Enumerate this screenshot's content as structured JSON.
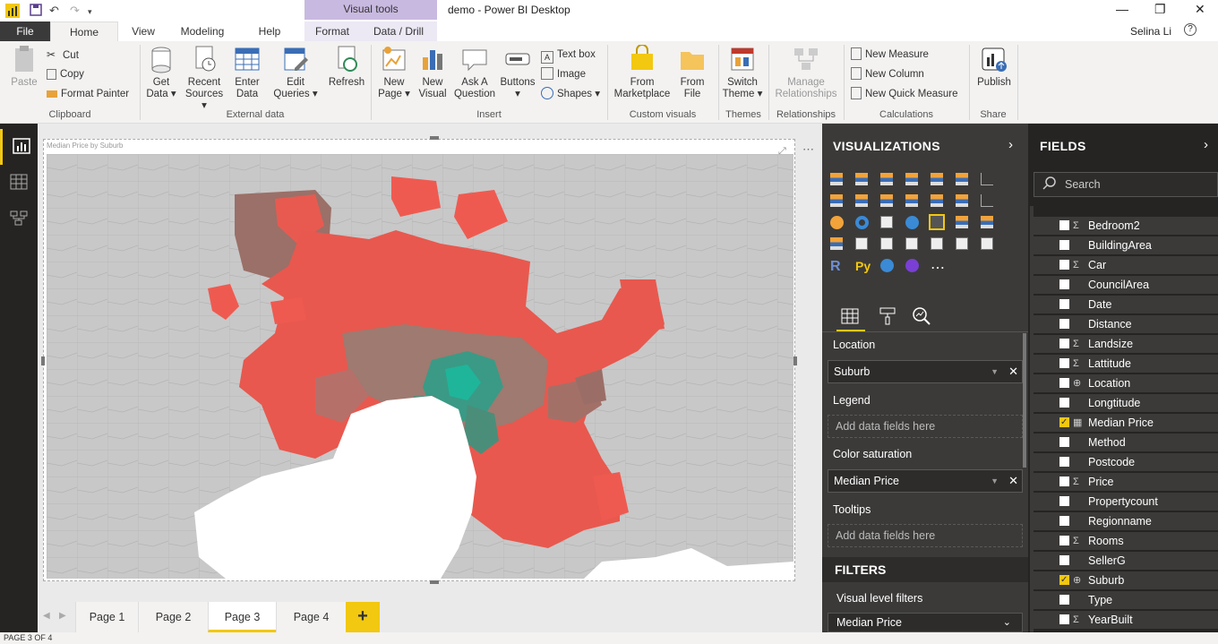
{
  "app": {
    "title": "demo - Power BI Desktop",
    "contextual_tab_group": "Visual tools",
    "user": "Selina Li",
    "help": "?"
  },
  "tabs": [
    "File",
    "Home",
    "View",
    "Modeling",
    "Help",
    "Format",
    "Data / Drill"
  ],
  "ribbon": {
    "clipboard": {
      "label": "Clipboard",
      "paste": "Paste",
      "cut": "Cut",
      "copy": "Copy",
      "format_painter": "Format Painter"
    },
    "external_data": {
      "label": "External data",
      "get_data": [
        "Get",
        "Data"
      ],
      "recent_sources": [
        "Recent",
        "Sources"
      ],
      "enter_data": [
        "Enter",
        "Data"
      ],
      "edit_queries": [
        "Edit",
        "Queries"
      ],
      "refresh": "Refresh"
    },
    "insert": {
      "label": "Insert",
      "new_page": [
        "New",
        "Page"
      ],
      "new_visual": [
        "New",
        "Visual"
      ],
      "ask_question": [
        "Ask A",
        "Question"
      ],
      "buttons": "Buttons",
      "text_box": "Text box",
      "image": "Image",
      "shapes": "Shapes"
    },
    "custom_visuals": {
      "label": "Custom visuals",
      "from_marketplace": [
        "From",
        "Marketplace"
      ],
      "from_file": [
        "From",
        "File"
      ]
    },
    "themes": {
      "label": "Themes",
      "switch_theme": [
        "Switch",
        "Theme"
      ]
    },
    "relationships": {
      "label": "Relationships",
      "manage": [
        "Manage",
        "Relationships"
      ]
    },
    "calculations": {
      "label": "Calculations",
      "new_measure": "New Measure",
      "new_column": "New Column",
      "new_quick_measure": "New Quick Measure"
    },
    "share": {
      "label": "Share",
      "publish": "Publish"
    }
  },
  "visual": {
    "title": "Median Price by Suburb"
  },
  "pages": [
    "Page 1",
    "Page 2",
    "Page 3",
    "Page 4"
  ],
  "add_page": "+",
  "status": "PAGE 3 OF 4",
  "visualizations": {
    "title": "VISUALIZATIONS",
    "location_label": "Location",
    "location_value": "Suburb",
    "legend_label": "Legend",
    "legend_placeholder": "Add data fields here",
    "color_saturation_label": "Color saturation",
    "color_saturation_value": "Median Price",
    "tooltips_label": "Tooltips",
    "tooltips_placeholder": "Add data fields here",
    "r_label": "R",
    "py_label": "Py"
  },
  "filters": {
    "title": "FILTERS",
    "visual_level_label": "Visual level filters",
    "visual_level_value": "Median Price"
  },
  "fields": {
    "title": "FIELDS",
    "search_placeholder": "Search",
    "items": [
      {
        "name": "Bedroom2",
        "type": "Σ",
        "checked": false
      },
      {
        "name": "BuildingArea",
        "type": "",
        "checked": false
      },
      {
        "name": "Car",
        "type": "Σ",
        "checked": false
      },
      {
        "name": "CouncilArea",
        "type": "",
        "checked": false
      },
      {
        "name": "Date",
        "type": "",
        "checked": false
      },
      {
        "name": "Distance",
        "type": "",
        "checked": false
      },
      {
        "name": "Landsize",
        "type": "Σ",
        "checked": false
      },
      {
        "name": "Lattitude",
        "type": "Σ",
        "checked": false
      },
      {
        "name": "Location",
        "type": "globe",
        "checked": false
      },
      {
        "name": "Longtitude",
        "type": "",
        "checked": false
      },
      {
        "name": "Median Price",
        "type": "calc",
        "checked": true
      },
      {
        "name": "Method",
        "type": "",
        "checked": false
      },
      {
        "name": "Postcode",
        "type": "",
        "checked": false
      },
      {
        "name": "Price",
        "type": "Σ",
        "checked": false
      },
      {
        "name": "Propertycount",
        "type": "",
        "checked": false
      },
      {
        "name": "Regionname",
        "type": "",
        "checked": false
      },
      {
        "name": "Rooms",
        "type": "Σ",
        "checked": false
      },
      {
        "name": "SellerG",
        "type": "",
        "checked": false
      },
      {
        "name": "Suburb",
        "type": "globe",
        "checked": true
      },
      {
        "name": "Type",
        "type": "",
        "checked": false
      },
      {
        "name": "YearBuilt",
        "type": "Σ",
        "checked": false
      }
    ]
  },
  "colors": {
    "accent": "#f2c811",
    "map_high": "#ef5a50",
    "map_mid": "#9a7a70",
    "map_low": "#2aa58e",
    "map_bg": "#c8c8c8"
  }
}
